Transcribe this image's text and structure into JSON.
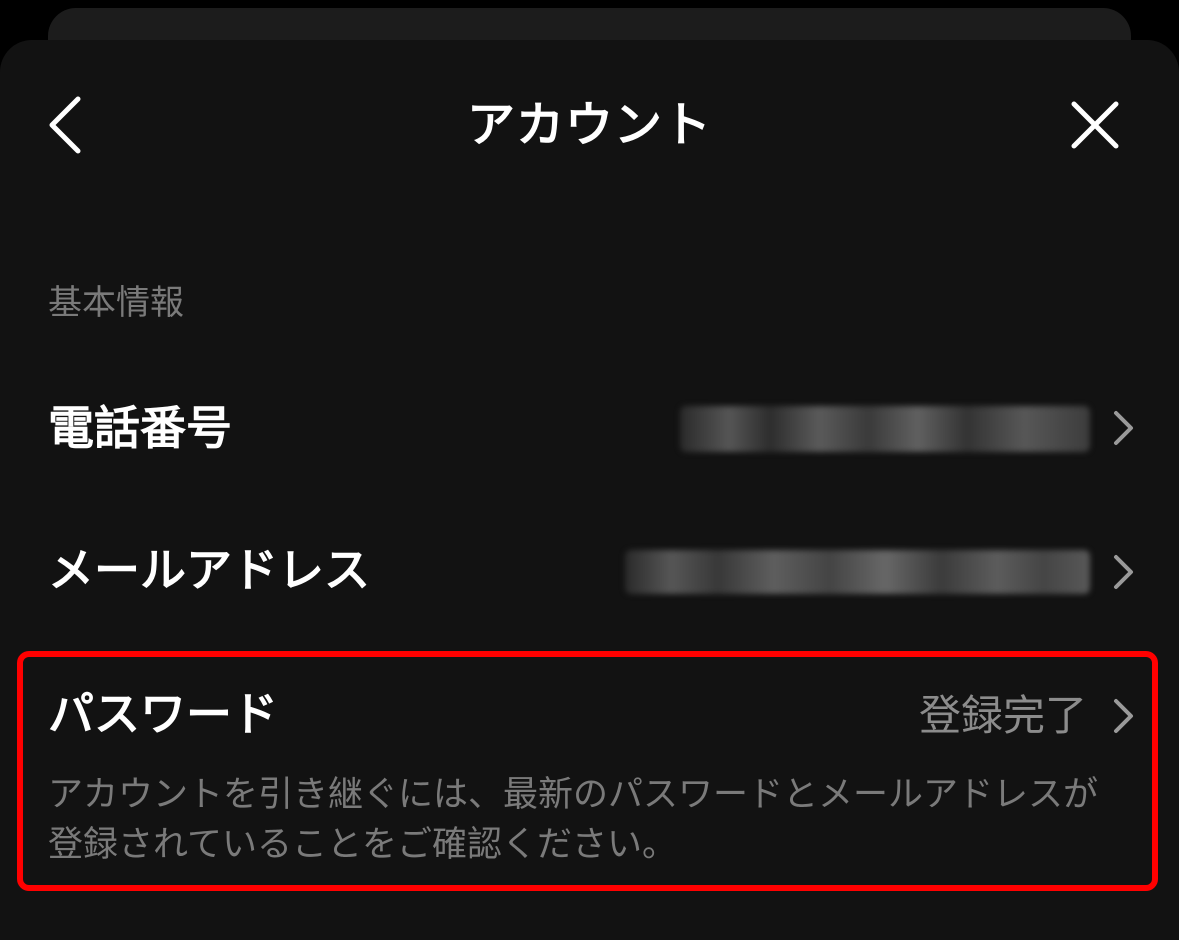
{
  "header": {
    "title": "アカウント",
    "back_icon": "chevron-left-icon",
    "close_icon": "close-icon"
  },
  "section": {
    "label": "基本情報"
  },
  "rows": [
    {
      "label": "電話番号",
      "value_redacted": true,
      "icon": "chevron-right-icon"
    },
    {
      "label": "メールアドレス",
      "value_redacted": true,
      "icon": "chevron-right-icon"
    },
    {
      "label": "パスワード",
      "value": "登録完了",
      "icon": "chevron-right-icon"
    }
  ],
  "password_help": {
    "line1": "アカウントを引き継ぐには、最新のパスワードとメールアドレスが",
    "line2": "登録されていることをご確認ください。"
  },
  "colors": {
    "background": "#121212",
    "text_primary": "#ffffff",
    "text_secondary": "#7a7a7a",
    "highlight": "#ff0000"
  }
}
